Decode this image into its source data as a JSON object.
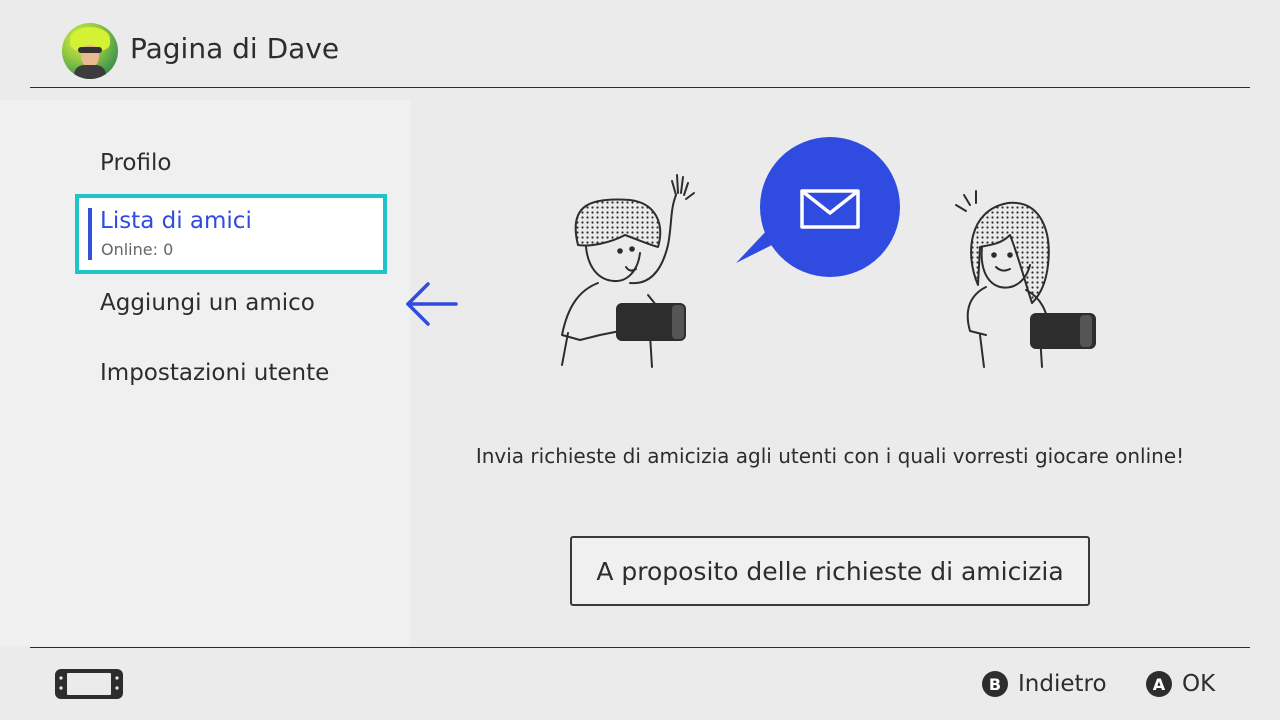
{
  "header": {
    "title": "Pagina di Dave",
    "avatar_icon": "user-avatar"
  },
  "sidebar": {
    "items": [
      {
        "label": "Profilo"
      },
      {
        "label": "Lista di amici",
        "sublabel": "Online: 0",
        "selected": true
      },
      {
        "label": "Aggiungi un amico"
      },
      {
        "label": "Impostazioni utente"
      }
    ]
  },
  "main": {
    "illustration_icon": "friend-request-illustration",
    "message_icon": "envelope-icon",
    "description": "Invia richieste di amicizia agli utenti con i quali vorresti giocare online!",
    "info_button": "A proposito delle richieste di amicizia"
  },
  "footer": {
    "back": {
      "key": "B",
      "label": "Indietro"
    },
    "ok": {
      "key": "A",
      "label": "OK"
    }
  },
  "colors": {
    "accent_blue": "#2f4be0",
    "selection_border": "#1fc3c8",
    "bubble_blue": "#2f4be0",
    "background": "#ebebeb"
  }
}
